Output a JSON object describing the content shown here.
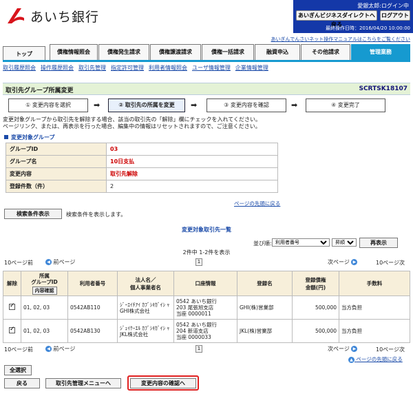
{
  "header": {
    "bank_name": "あいち銀行",
    "user": "愛銀太郎:ログイン中",
    "biz_direct_button": "あいぎんビジネスダイレクトへ戻る",
    "logout_button": "ログアウト",
    "last_operation": "最終操作日時：2016/04/20 10:00:00",
    "manual_link": "あいぎんでんさいネット操作マニュアルはこちらをご覧ください"
  },
  "tabs": [
    "トップ",
    "債権情報照会",
    "債権発生請求",
    "債権譲渡請求",
    "債権一括請求",
    "融資申込",
    "その他請求",
    "管理業務"
  ],
  "subnav": [
    "取引履歴照会",
    "操作履歴照会",
    "取引先管理",
    "指定許可管理",
    "利用者情報照会",
    "ユーザ情報管理",
    "企業情報管理"
  ],
  "page": {
    "title": "取引先グループ所属変更",
    "code": "SCRTSK18107"
  },
  "steps": [
    "① 変更内容を選択",
    "② 取引先の所属を変更",
    "③ 変更内容を確認",
    "④ 変更完了"
  ],
  "description": [
    "変更対象グループから取引先を解除する場合、該当の取引先の「解除」欄にチェックを入れてください。",
    "ページリンク、または、再表示を行った場合、編集中の情報はリセットされますので、ご注意ください。"
  ],
  "target_group": {
    "heading": "変更対象グループ",
    "rows": [
      {
        "label": "グループID",
        "value": "03"
      },
      {
        "label": "グループ名",
        "value": "10日支払"
      },
      {
        "label": "変更内容",
        "value": "取引先解除"
      },
      {
        "label": "登録件数（件）",
        "value": "2"
      }
    ]
  },
  "page_top_link": "ページの先頭に戻る",
  "search_button": "検索条件表示",
  "search_note": "検索条件を表示します。",
  "list": {
    "title": "変更対象取引先一覧",
    "sort_label": "並び順:",
    "sort_field": "利用者番号",
    "sort_order": "昇順",
    "redisplay_button": "再表示",
    "count_text": "2件中 1-2件を表示",
    "prev10": "10ページ前",
    "prev": "前ページ",
    "next": "次ページ",
    "next10": "10ページ次",
    "current_page": "1",
    "headers": {
      "release": "解除",
      "group_id": "所属\nグループID",
      "group_id_btn": "内容確認",
      "user_no": "利用者番号",
      "name": "法人名／\n個人事業者名",
      "account": "口座情報",
      "registered_name": "登録名",
      "limit": "登録債権\n金額(円)",
      "fee": "手数料"
    },
    "rows": [
      {
        "group_id": "01, 02, 03",
        "user_no": "0542AB110",
        "name_kana": "ｼﾞｰｴｲﾁｱｲ ｶﾌﾞｼｷｶﾞｲｼ ｬ",
        "name": "GHI株式会社",
        "account1": "0542 あいち銀行",
        "account2": "203 尾張旭支店",
        "account3": "当座 0000011",
        "registered_name": "GHI(株)営業部",
        "amount": "500,000",
        "fee": "当方負担"
      },
      {
        "group_id": "01, 02, 03",
        "user_no": "0542AB130",
        "name_kana": "ｼﾞｪｲｹｰｴﾙ ｶﾌﾞｼｷｶﾞｲｼ ｬ",
        "name": "JKL株式会社",
        "account1": "0542 あいち銀行",
        "account2": "204 新道支店",
        "account3": "当座 0000033",
        "registered_name": "JKL(株)営業部",
        "amount": "500,000",
        "fee": "当方負担"
      }
    ]
  },
  "footer": {
    "select_all": "全選択",
    "back": "戻る",
    "menu": "取引先管理メニューへ",
    "confirm": "変更内容の確認へ"
  }
}
